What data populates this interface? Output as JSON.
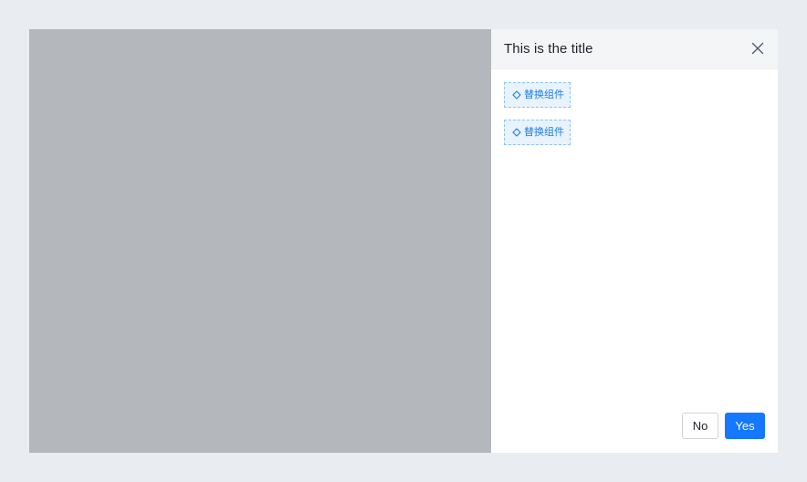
{
  "drawer": {
    "title": "This is the title",
    "close_icon": "close-icon",
    "placeholders": [
      {
        "icon": "diamond-icon",
        "label": "替换组件"
      },
      {
        "icon": "diamond-icon",
        "label": "替换组件"
      }
    ],
    "footer": {
      "cancel_label": "No",
      "confirm_label": "Yes"
    }
  },
  "colors": {
    "page_background": "#e9ecf0",
    "mask": "#b4b7bb",
    "header_background": "#f4f5f7",
    "primary": "#1677ff",
    "placeholder_border": "#8fc3f3",
    "placeholder_background": "#e8f3fe",
    "placeholder_text": "#1e7de2"
  }
}
